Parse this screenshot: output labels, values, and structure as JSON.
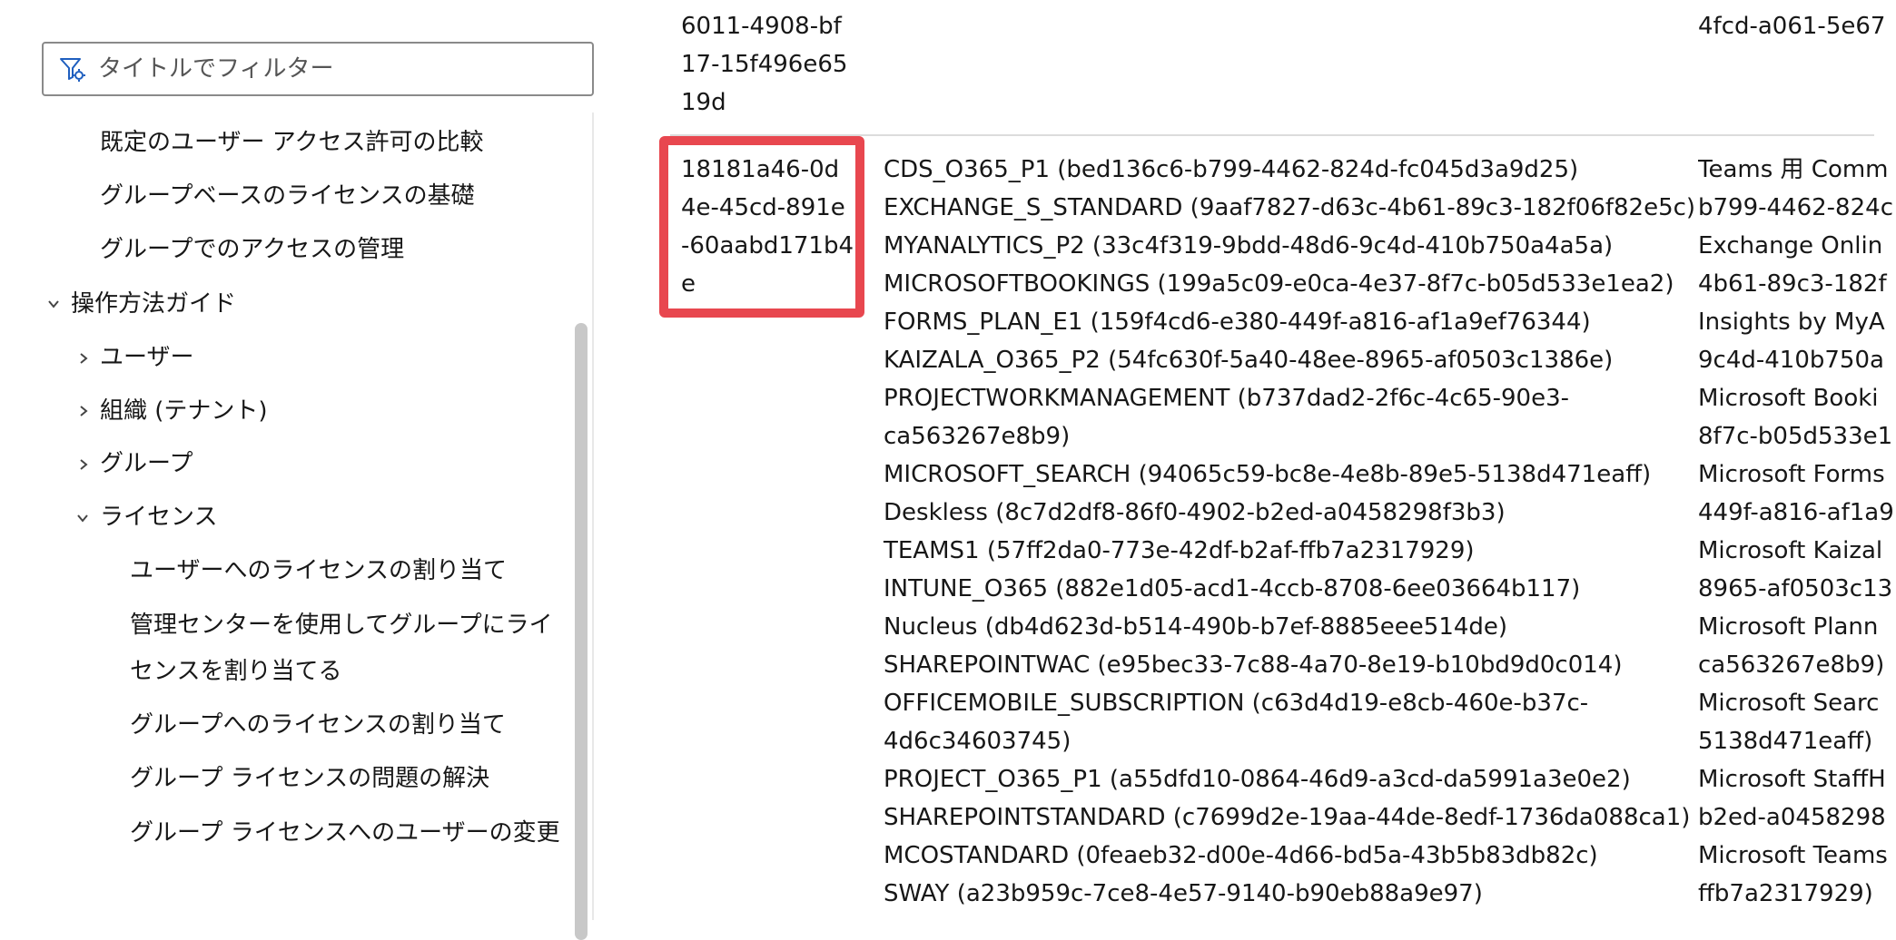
{
  "sidebar": {
    "filter_placeholder": "タイトルでフィルター",
    "items": [
      {
        "label": "既定のユーザー アクセス許可の比較"
      },
      {
        "label": "グループベースのライセンスの基礎"
      },
      {
        "label": "グループでのアクセスの管理"
      },
      {
        "label": "操作方法ガイド",
        "state": "expanded"
      },
      {
        "label": "ユーザー",
        "state": "collapsed"
      },
      {
        "label": "組織 (テナント)",
        "state": "collapsed"
      },
      {
        "label": "グループ",
        "state": "collapsed"
      },
      {
        "label": "ライセンス",
        "state": "expanded"
      },
      {
        "label": "ユーザーへのライセンスの割り当て"
      },
      {
        "label": "管理センターを使用してグループにライセンスを割り当てる"
      },
      {
        "label": "グループへのライセンスの割り当て"
      },
      {
        "label": "グループ ライセンスの問題の解決"
      },
      {
        "label": "グループ ライセンスへのユーザーの変更"
      }
    ]
  },
  "table": {
    "prev_row": {
      "guid": "6011-4908-bf17-15f496e6519d",
      "friendly_fragment": "4fcd-a061-5e67"
    },
    "row": {
      "guid": "18181a46-0d4e-45cd-891e-60aabd171b4e",
      "service_plans": [
        "CDS_O365_P1 (bed136c6-b799-4462-824d-fc045d3a9d25)",
        "EXCHANGE_S_STANDARD (9aaf7827-d63c-4b61-89c3-182f06f82e5c)",
        "MYANALYTICS_P2 (33c4f319-9bdd-48d6-9c4d-410b750a4a5a)",
        "MICROSOFTBOOKINGS (199a5c09-e0ca-4e37-8f7c-b05d533e1ea2)",
        "FORMS_PLAN_E1 (159f4cd6-e380-449f-a816-af1a9ef76344)",
        "KAIZALA_O365_P2 (54fc630f-5a40-48ee-8965-af0503c1386e)",
        "PROJECTWORKMANAGEMENT (b737dad2-2f6c-4c65-90e3-",
        "ca563267e8b9)",
        "MICROSOFT_SEARCH (94065c59-bc8e-4e8b-89e5-5138d471eaff)",
        "Deskless (8c7d2df8-86f0-4902-b2ed-a0458298f3b3)",
        "TEAMS1 (57ff2da0-773e-42df-b2af-ffb7a2317929)",
        "INTUNE_O365 (882e1d05-acd1-4ccb-8708-6ee03664b117)",
        "Nucleus (db4d623d-b514-490b-b7ef-8885eee514de)",
        "SHAREPOINTWAC (e95bec33-7c88-4a70-8e19-b10bd9d0c014)",
        "OFFICEMOBILE_SUBSCRIPTION (c63d4d19-e8cb-460e-b37c-",
        "4d6c34603745)",
        "PROJECT_O365_P1 (a55dfd10-0864-46d9-a3cd-da5991a3e0e2)",
        "SHAREPOINTSTANDARD (c7699d2e-19aa-44de-8edf-1736da088ca1)",
        "MCOSTANDARD (0feaeb32-d00e-4d66-bd5a-43b5b83db82c)",
        "SWAY (a23b959c-7ce8-4e57-9140-b90eb88a9e97)"
      ],
      "friendly_names": [
        "Teams 用 Comm",
        "b799-4462-824c",
        "Exchange Onlin",
        "4b61-89c3-182f",
        "Insights by MyA",
        "9c4d-410b750a",
        "Microsoft Booki",
        "8f7c-b05d533e1",
        "Microsoft Forms",
        "449f-a816-af1a9",
        "Microsoft Kaizal",
        "8965-af0503c13",
        "Microsoft Plann",
        "ca563267e8b9)",
        "Microsoft Searc",
        "5138d471eaff)",
        "Microsoft StaffH",
        "b2ed-a0458298",
        "Microsoft Teams",
        "ffb7a2317929)"
      ]
    }
  },
  "colors": {
    "highlight": "#e8474f",
    "scrollbar": "#c8c8c8"
  }
}
